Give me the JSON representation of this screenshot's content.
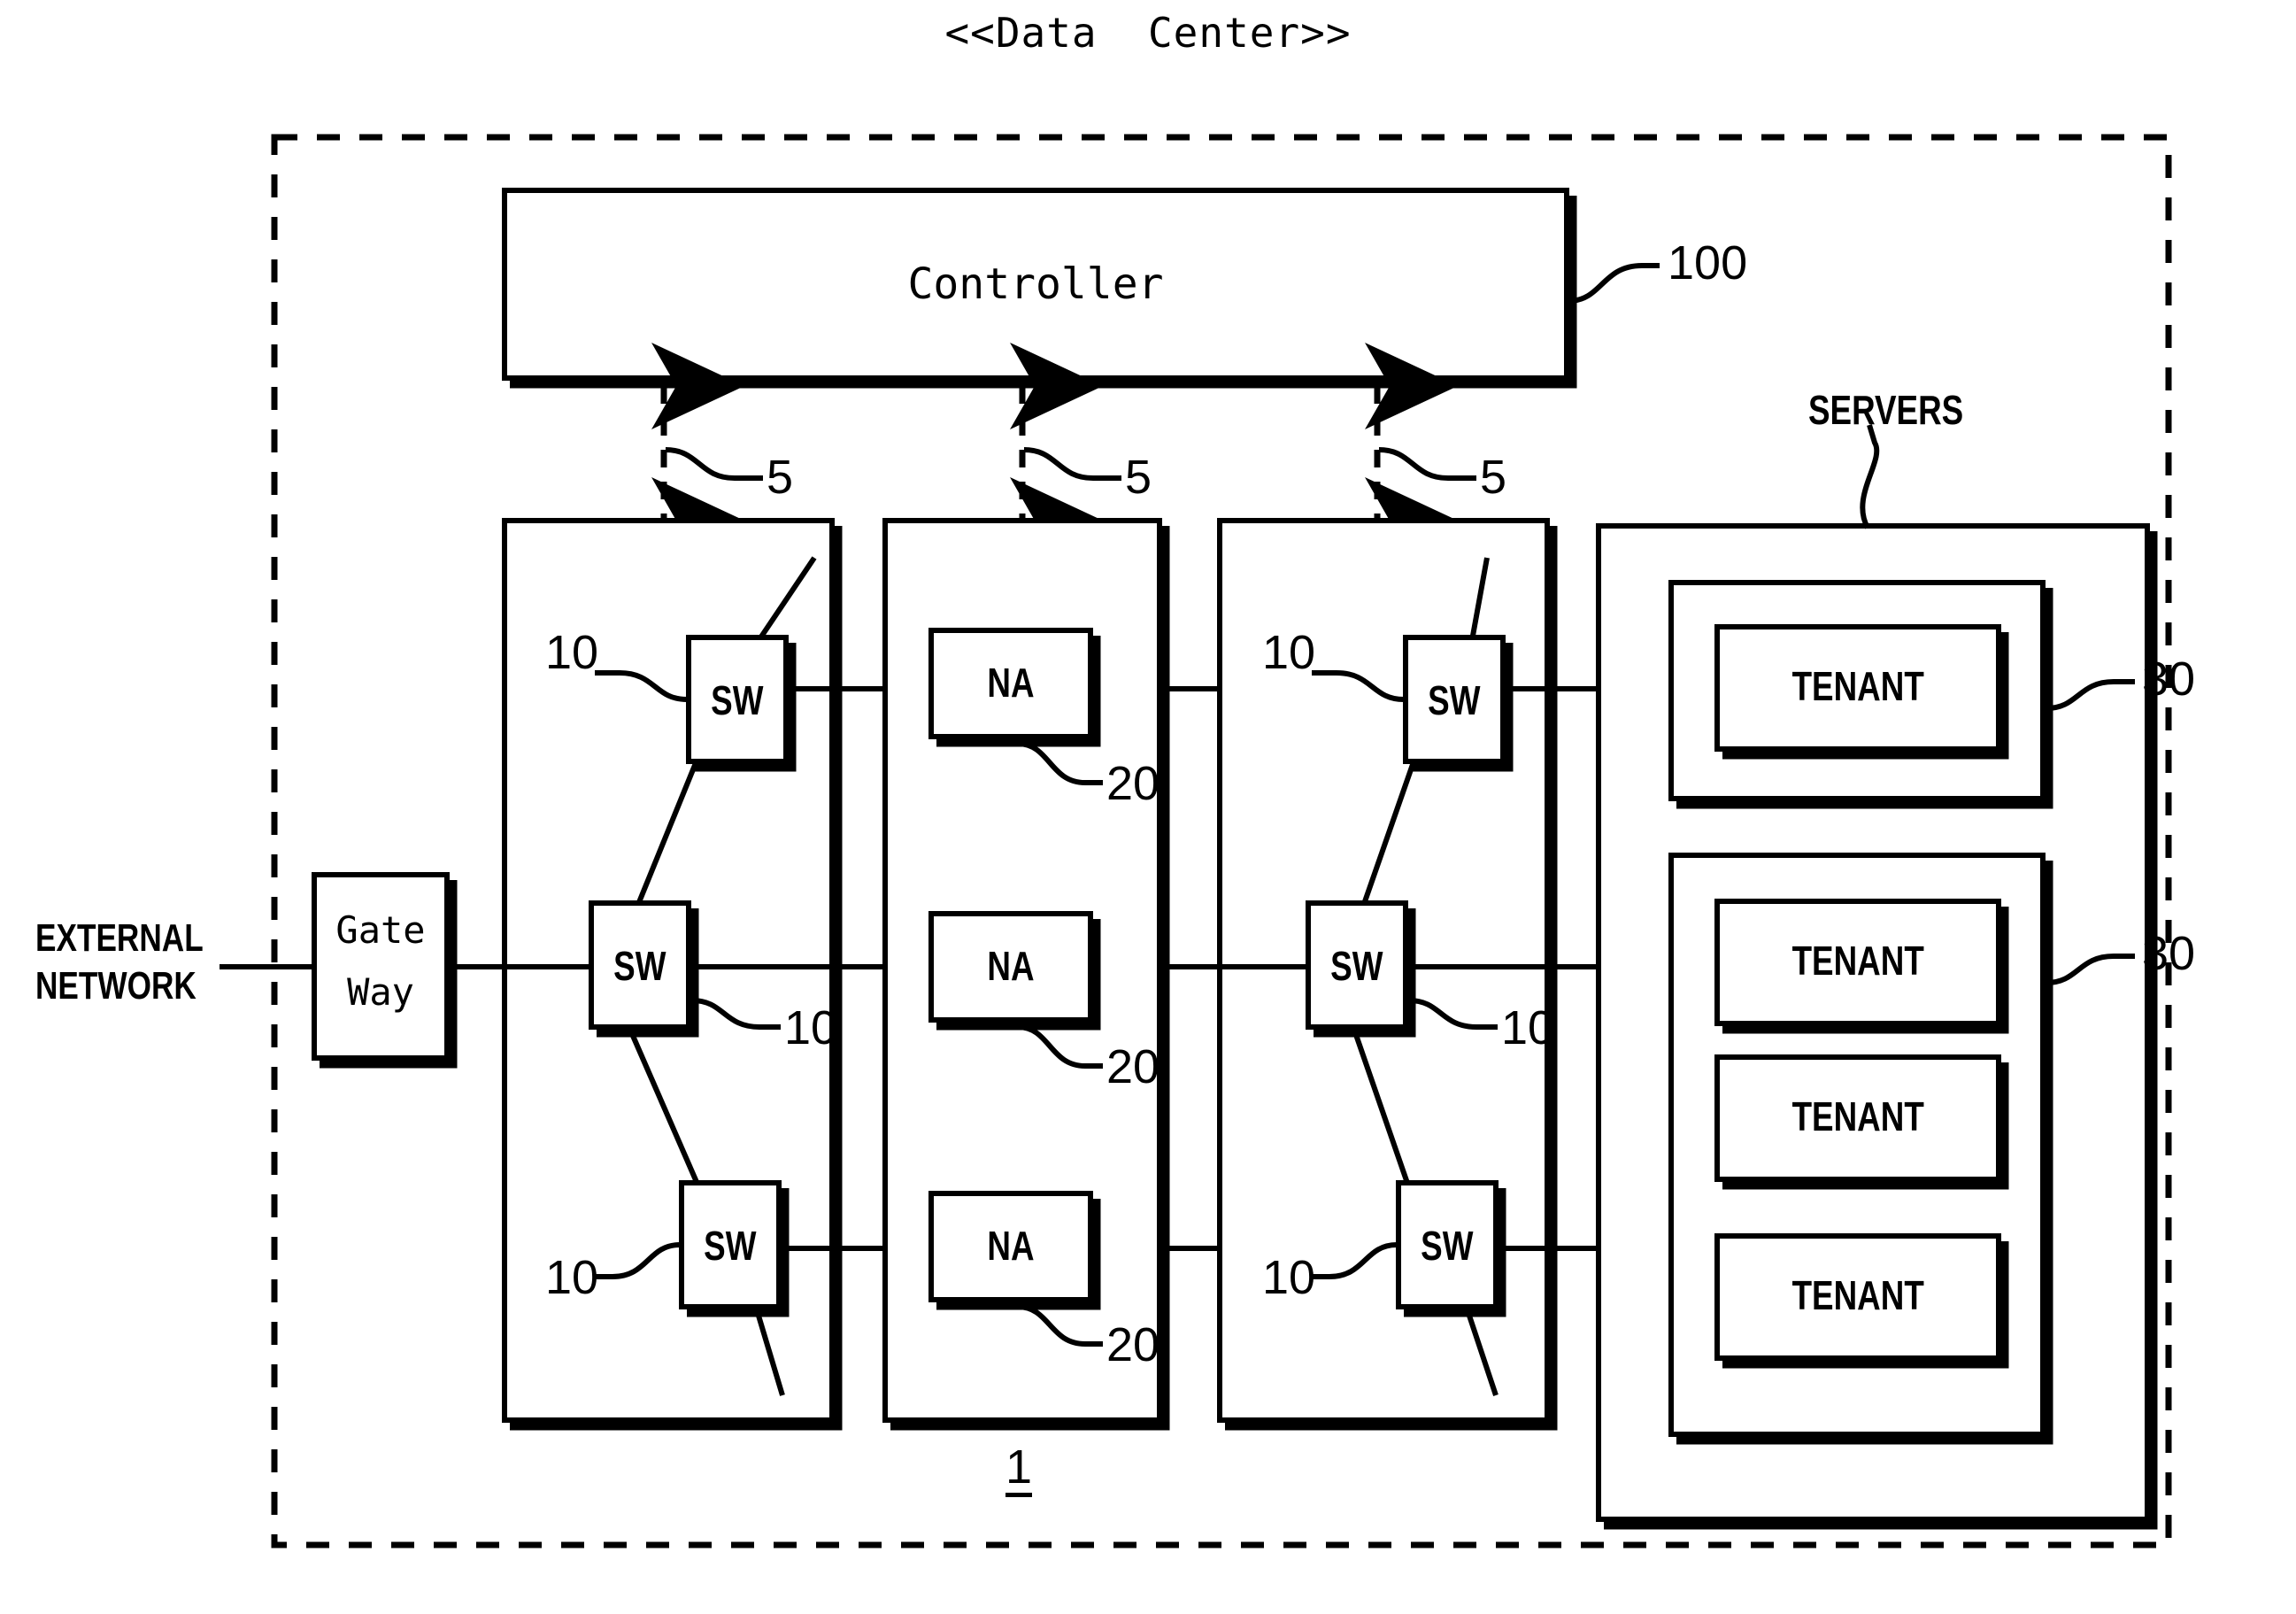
{
  "diagram": {
    "title": "<<Data  Center>>",
    "outer_boundary_style": "dashed",
    "system_label": "1",
    "external_network_label": "EXTERNAL\nNETWORK",
    "external_network_line1": "EXTERNAL",
    "external_network_line2": "NETWORK",
    "servers_label": "SERVERS",
    "ink_color": "#000000",
    "background_color": "#ffffff"
  },
  "controller": {
    "label": "Controller",
    "ref": "100"
  },
  "gateway": {
    "line1": "Gate",
    "line2": "Way"
  },
  "control_links": [
    {
      "ref": "5"
    },
    {
      "ref": "5"
    },
    {
      "ref": "5"
    }
  ],
  "switch_column_1": {
    "nodes": [
      {
        "label": "SW",
        "ref": "10",
        "ref_side": "left"
      },
      {
        "label": "SW",
        "ref": "10",
        "ref_side": "right"
      },
      {
        "label": "SW",
        "ref": "10",
        "ref_side": "left"
      }
    ]
  },
  "appliance_column": {
    "nodes": [
      {
        "label": "NA",
        "ref": "20"
      },
      {
        "label": "NA",
        "ref": "20"
      },
      {
        "label": "NA",
        "ref": "20"
      }
    ]
  },
  "switch_column_2": {
    "nodes": [
      {
        "label": "SW",
        "ref": "10",
        "ref_side": "left"
      },
      {
        "label": "SW",
        "ref": "10",
        "ref_side": "right"
      },
      {
        "label": "SW",
        "ref": "10",
        "ref_side": "left"
      }
    ]
  },
  "servers": {
    "groups": [
      {
        "ref": "30",
        "tenants": [
          {
            "label": "TENANT"
          }
        ]
      },
      {
        "ref": "30",
        "tenants": [
          {
            "label": "TENANT"
          },
          {
            "label": "TENANT"
          },
          {
            "label": "TENANT"
          }
        ]
      }
    ]
  }
}
